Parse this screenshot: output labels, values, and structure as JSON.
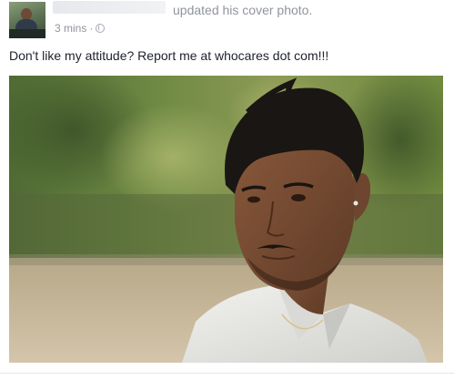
{
  "post": {
    "author_action": "updated his cover photo.",
    "timestamp": "3 mins",
    "separator": "·",
    "privacy_icon": "globe-icon",
    "status_text": "Don't like my attitude? Report me at whocares dot com!!!",
    "photo_description_icon": "cover-photo"
  },
  "colors": {
    "meta_text": "#90949c",
    "body_text": "#1d2129",
    "background": "#ffffff"
  }
}
